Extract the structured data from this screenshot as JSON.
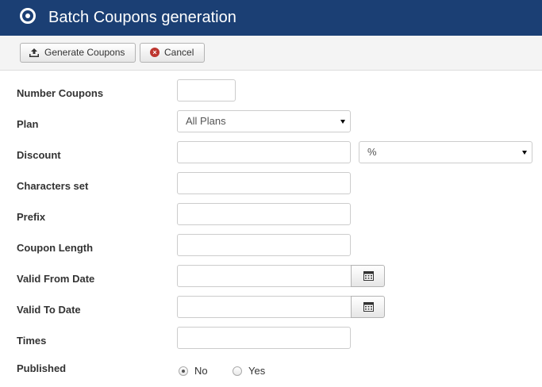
{
  "header": {
    "title": "Batch Coupons generation",
    "icon": "circle-dot-icon"
  },
  "toolbar": {
    "generate_label": "Generate Coupons",
    "cancel_label": "Cancel"
  },
  "form": {
    "number_coupons": {
      "label": "Number Coupons",
      "value": ""
    },
    "plan": {
      "label": "Plan",
      "selected": "All Plans"
    },
    "discount": {
      "label": "Discount",
      "value": "",
      "type_selected": "%"
    },
    "characters_set": {
      "label": "Characters set",
      "value": ""
    },
    "prefix": {
      "label": "Prefix",
      "value": ""
    },
    "coupon_length": {
      "label": "Coupon Length",
      "value": ""
    },
    "valid_from": {
      "label": "Valid From Date",
      "value": ""
    },
    "valid_to": {
      "label": "Valid To Date",
      "value": ""
    },
    "times": {
      "label": "Times",
      "value": ""
    },
    "published": {
      "label": "Published",
      "options": [
        "No",
        "Yes"
      ],
      "selected": "No"
    }
  },
  "colors": {
    "header_bg": "#1b3f74",
    "cancel_icon": "#bd362f"
  }
}
